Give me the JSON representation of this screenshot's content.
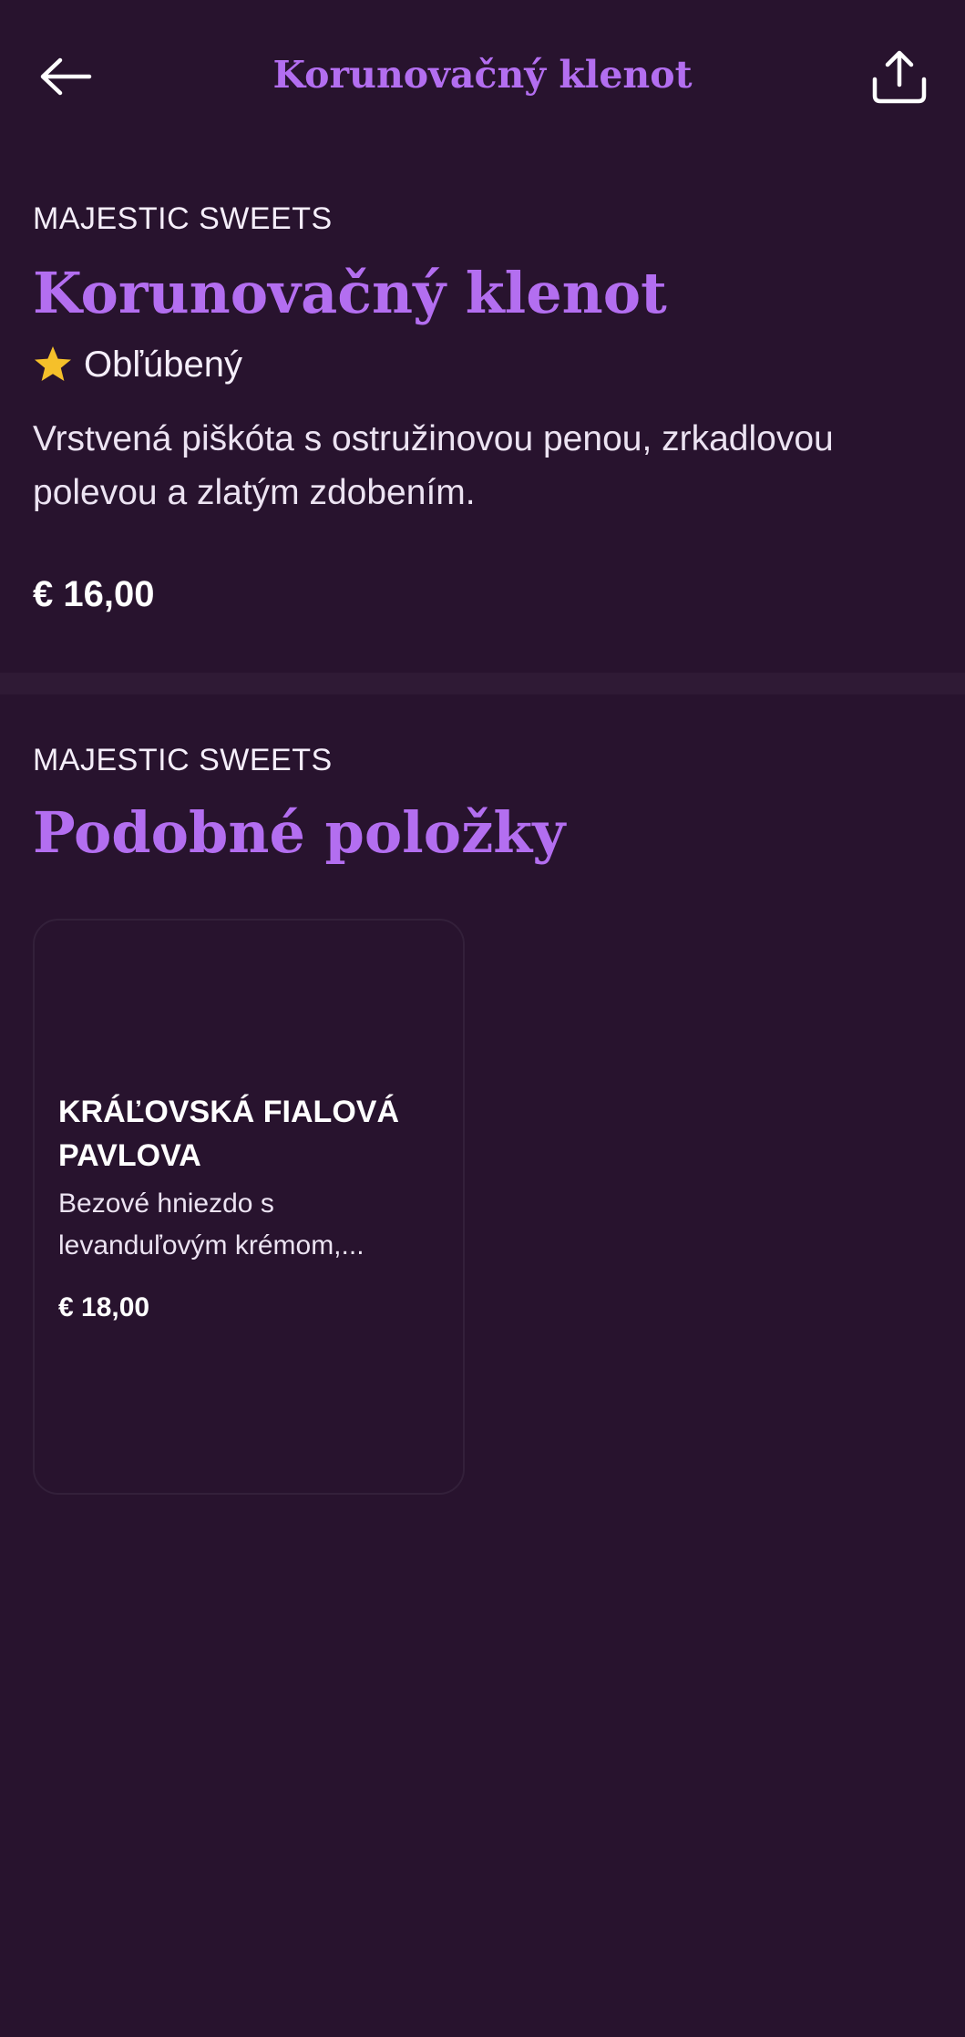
{
  "header": {
    "title": "Korunovačný klenot",
    "back_icon": "arrow-left-icon",
    "share_icon": "share-icon"
  },
  "product": {
    "brand": "MAJESTIC SWEETS",
    "title": "Korunovačný klenot",
    "badge_icon": "star-icon",
    "badge_label": "Obľúbený",
    "description": "Vrstvená piškóta s ostružinovou penou, zrkadlovou polevou a zlatým zdobením.",
    "price": "€ 16,00"
  },
  "similar": {
    "brand": "MAJESTIC SWEETS",
    "title": "Podobné položky",
    "items": [
      {
        "name": "KRÁĽOVSKÁ FIALOVÁ PAVLOVA",
        "description": "Bezové hniezdo s levanduľovým krémom,...",
        "price": "€ 18,00"
      }
    ]
  },
  "colors": {
    "background": "#28132e",
    "accent": "#b36ef0",
    "divider": "#2f1a35",
    "star": "#f5c02a",
    "text": "#ffffff"
  }
}
